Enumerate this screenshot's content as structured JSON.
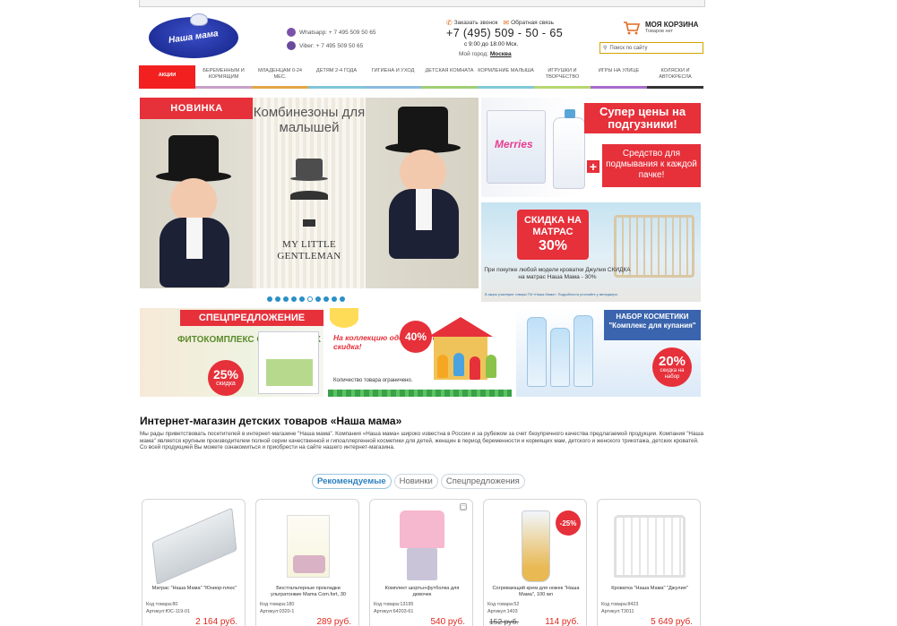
{
  "header": {
    "logo_text": "Наша мама",
    "whatsapp": "Whatsapp: + 7 495 509 50 65",
    "viber": "Viber: + 7 495 509 50 65",
    "callback_label": "Заказать звонок",
    "feedback_label": "Обратная связь",
    "phone": "+7 (495) 509 - 50 - 65",
    "hours": "с 9:00 до 18:00 Мск.",
    "city_label": "Мой город:",
    "city_value": "Москва",
    "cart_title": "МОЯ КОРЗИНА",
    "cart_sub": "Товаров нет",
    "search_placeholder": "Поиск по сайту"
  },
  "menu": [
    {
      "label": "АКЦИИ",
      "color": "#f32020"
    },
    {
      "label": "БЕРЕМЕННЫМ И КОРМЯЩИМ",
      "color": "#c8a0c8"
    },
    {
      "label": "МЛАДЕНЦАМ 0-24 МЕС.",
      "color": "#e3a64a"
    },
    {
      "label": "ДЕТЯМ 2-4 ГОДА",
      "color": "#7fc6d8"
    },
    {
      "label": "ГИГИЕНА И УХОД",
      "color": "#8bbbe0"
    },
    {
      "label": "ДЕТСКАЯ КОМНАТА",
      "color": "#9fcf75"
    },
    {
      "label": "КОРМЛЕНИЕ МАЛЫША",
      "color": "#82c8d6"
    },
    {
      "label": "ИГРУШКИ И ТВОРЧЕСТВО",
      "color": "#b6d66f"
    },
    {
      "label": "ИГРЫ НА УЛИЦЕ",
      "color": "#a86bc9"
    },
    {
      "label": "КОЛЯСКИ И АВТОКРЕСЛА",
      "color": "#333333"
    }
  ],
  "banners": {
    "main_badge": "НОВИНКА",
    "main_title": "Комбинезоны для малышей",
    "main_label": "MY LITTLE GENTLEMAN",
    "slider_count": 10,
    "slider_active_index": 5,
    "merries_brand": "Merries",
    "merries_headline": "Супер цены на подгузники!",
    "merries_sub": "Средство для подмывания к каждой пачке!",
    "matras_headline": "СКИДКА НА МАТРАС",
    "matras_pct": "30%",
    "matras_note": "При покупке любой модели кроватки Джулия СКИДКА на матрас Наша Мама - 30%",
    "matras_fine": "В акции участвуют товары ТМ «Наша Мама». Подробности уточняйте у менеджера.",
    "fito_badge": "СПЕЦПРЕДЛОЖЕНИЕ",
    "fito_text": "ФИТОКОМПЛЕКС ОТ РАСТЯЖЕК",
    "fito_pct": "25%",
    "fito_pct_word": "скидка",
    "velor_text": "На коллекцию одежды из серии Велюр - скидка!",
    "velor_pct": "40%",
    "velor_foot": "Количество товара ограничено.",
    "kids_headline": "НАБОР КОСМЕТИКИ \"Комплекс для купания\"",
    "kids_pct": "20%",
    "kids_pct_word": "скидка на набор"
  },
  "content": {
    "title": "Интернет-магазин детских товаров «Наша мама»",
    "intro": "Мы рады приветствовать посетителей в интернет-магазине \"Наша мама\". Компания «Наша мама» широко известна в России и за рубежом за счет безупречного качества предлагаемой продукции. Компания \"Наша мама\" является крупным производителем полной серии качественной и гипоаллергенной косметики для детей, женщин в период беременности и кормящих мам, детского и женского трикотажа, детских кроватей. Со всей продукцией Вы можете ознакомиться и приобрести на сайте нашего интернет-магазина."
  },
  "tabs": [
    "Рекомендуемые",
    "Новинки",
    "Спецпредложения"
  ],
  "products": [
    {
      "name": "Матрас \"Наша Мама\" \"Юниор-плюс\"",
      "code": "Код товара:80",
      "sku": "Артикул:ЮС-119-01",
      "price": "2 164 руб.",
      "old_price": "",
      "badge": ""
    },
    {
      "name": "Бюстгальтерные прокладки ультратонкие Mama Com.fort, 30",
      "code": "Код товара:180",
      "sku": "Артикул:0320-1",
      "price": "289 руб.",
      "old_price": "",
      "badge": ""
    },
    {
      "name": "Комплект шорты+футболка для девочек",
      "code": "Код товара:13195",
      "sku": "Артикул:64203-61",
      "price": "540 руб.",
      "old_price": "",
      "badge": ""
    },
    {
      "name": "Согревающий крем для ножек \"Наша Мама\", 100 мл",
      "code": "Код товара:52",
      "sku": "Артикул:1403",
      "price": "114 руб.",
      "old_price": "152 руб.",
      "badge": "-25%"
    },
    {
      "name": "Кроватка \"Наша Мама\" \"Джулия\"",
      "code": "Код товара:8423",
      "sku": "Артикул:Т3011",
      "price": "5 649 руб.",
      "old_price": "",
      "badge": ""
    }
  ]
}
